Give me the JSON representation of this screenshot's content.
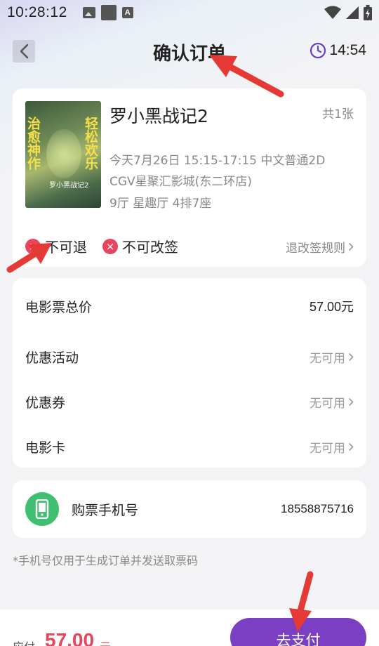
{
  "status_bar": {
    "time": "10:28:12"
  },
  "header": {
    "title": "确认订单",
    "timer": "14:54"
  },
  "movie": {
    "poster_text_left": "治愈神作",
    "poster_text_right": "轻松欢乐",
    "poster_logo": "罗小黑战记2",
    "title": "罗小黑战记2",
    "ticket_count": "共1张",
    "showtime": "今天7月26日 15:15-17:15  中文普通2D",
    "cinema": "CGV星聚汇影城(东二环店)",
    "seat": "9厅 星趣厅 4排7座",
    "policy_1": "不可退",
    "policy_2": "不可改签",
    "rules_link": "退改签规则",
    "policy_icon_char": "×"
  },
  "price": {
    "total_label": "电影票总价",
    "total_value": "57.00元",
    "promo_label": "优惠活动",
    "promo_value": "无可用",
    "coupon_label": "优惠券",
    "coupon_value": "无可用",
    "card_label": "电影卡",
    "card_value": "无可用"
  },
  "phone": {
    "label": "购票手机号",
    "number": "18558875716"
  },
  "note": "*手机号仅用于生成订单并发送取票码",
  "footer": {
    "pay_label": "应付",
    "amount": "57.00",
    "unit": "元",
    "pay_button": "去支付"
  },
  "colors": {
    "accent_purple": "#7a3fc2",
    "price_red": "#e8455f",
    "phone_green": "#3fc070",
    "annotation_red": "#e53935"
  }
}
